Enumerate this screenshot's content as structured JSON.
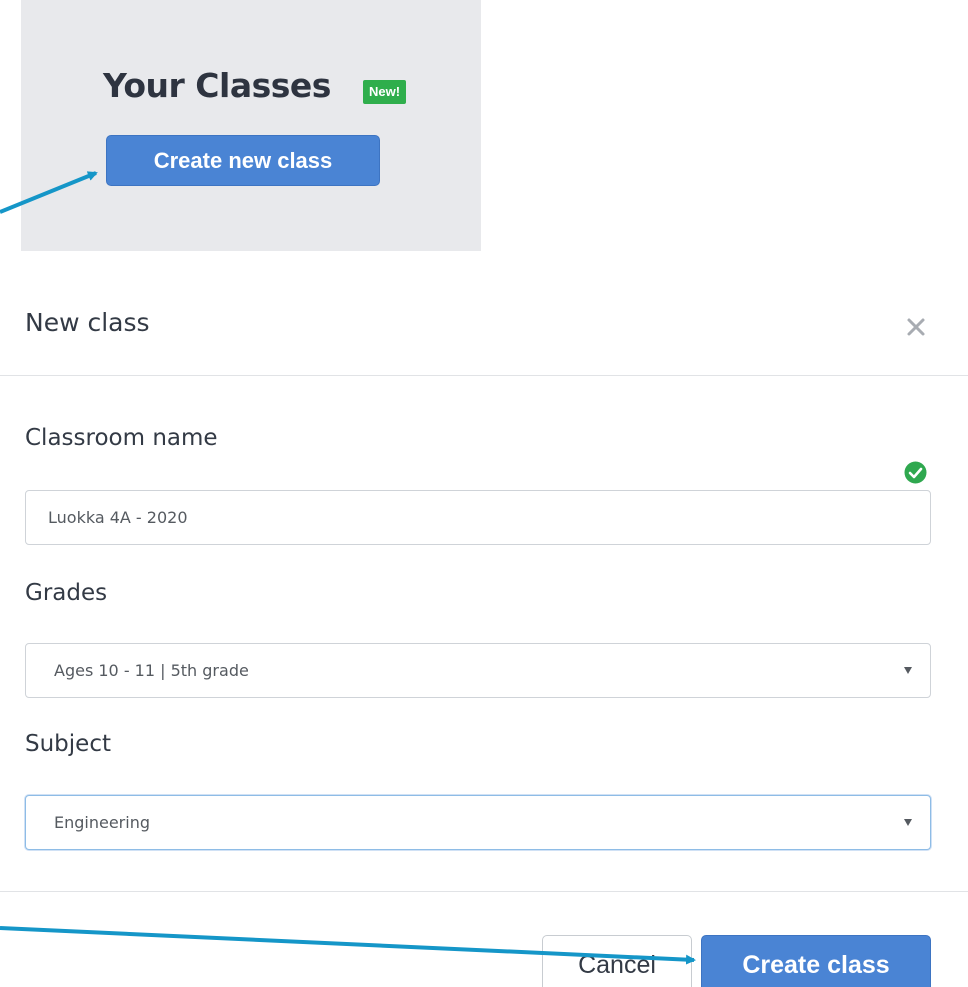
{
  "top_panel": {
    "title": "Your Classes",
    "badge": "New!",
    "create_button": "Create new class"
  },
  "modal": {
    "title": "New class",
    "close_icon": "close-icon",
    "fields": {
      "classroom_name": {
        "label": "Classroom name",
        "value": "Luokka 4A - 2020",
        "valid_icon": "check-circle-icon"
      },
      "grades": {
        "label": "Grades",
        "selected": "Ages 10 - 11 | 5th grade"
      },
      "subject": {
        "label": "Subject",
        "selected": "Engineering"
      }
    },
    "footer": {
      "cancel_label": "Cancel",
      "create_label": "Create class"
    }
  },
  "colors": {
    "primary": "#4a84d4",
    "badge": "#2fae4c",
    "arrow": "#1596c8",
    "panel_bg": "#e8e9ec"
  }
}
